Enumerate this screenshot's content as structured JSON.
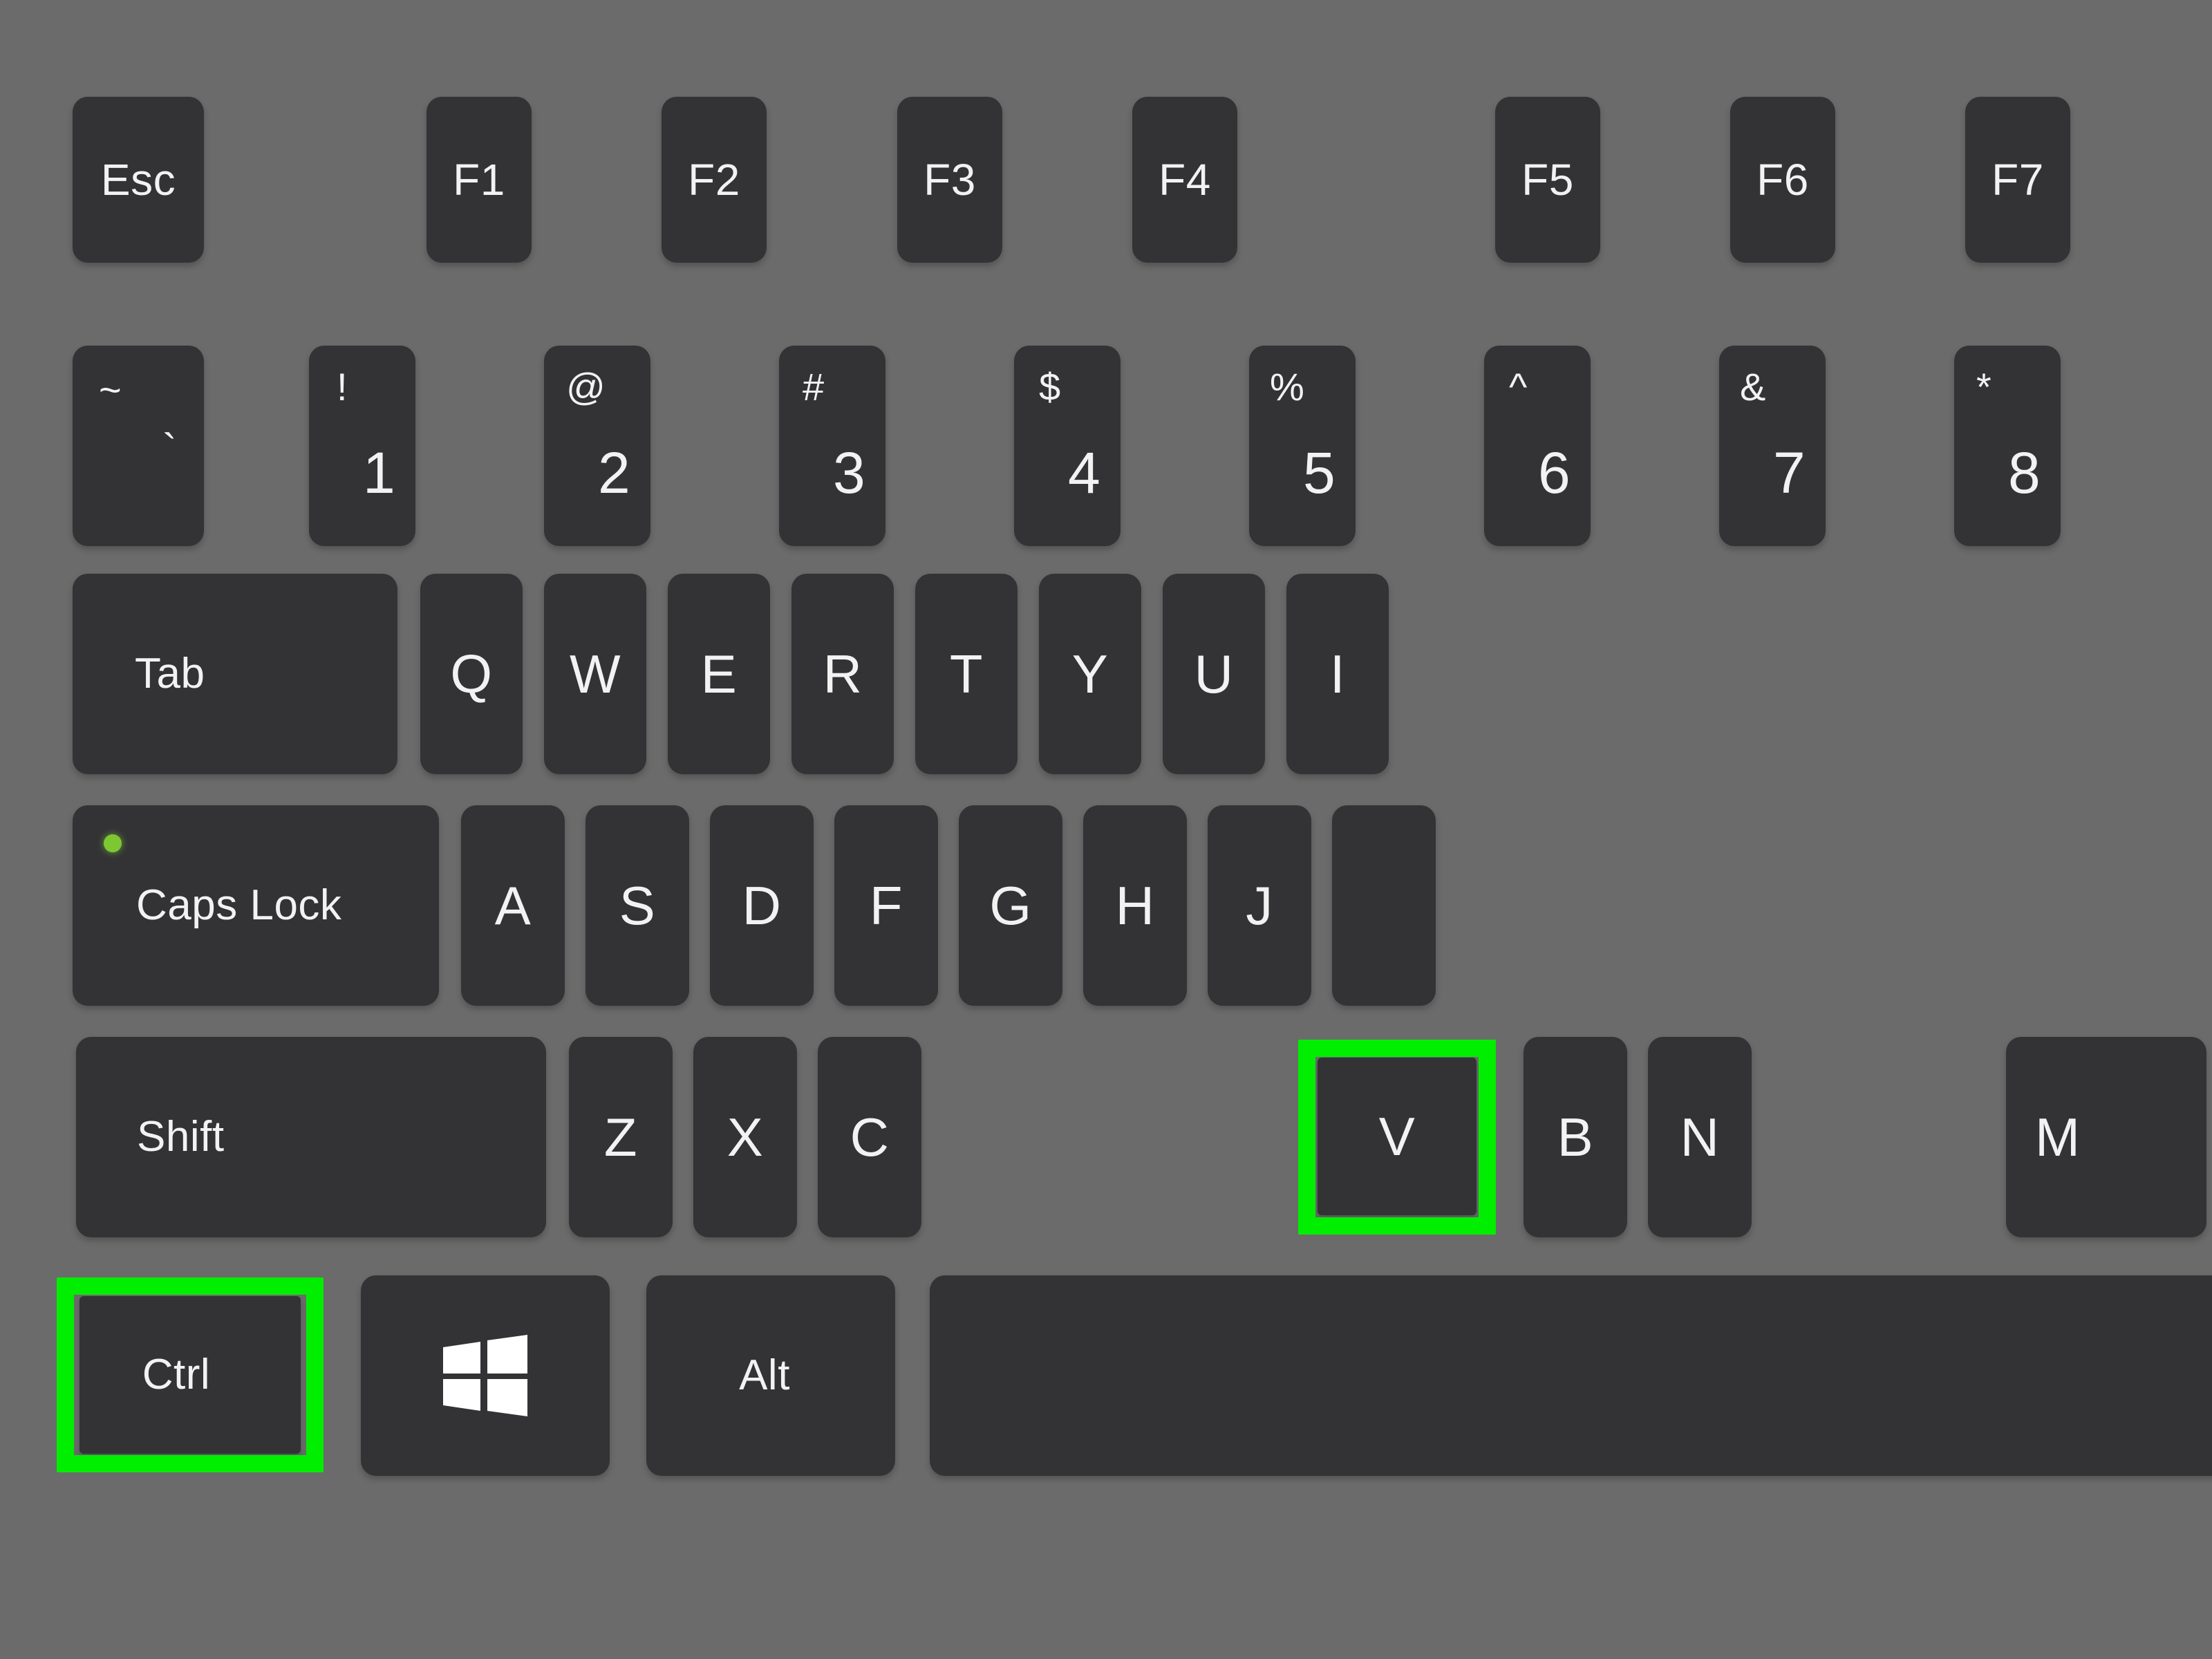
{
  "illustration": {
    "subject": "computer-keyboard",
    "layout": "ansi-qwerty-partial",
    "shortcut_shown": "Ctrl + V",
    "colors": {
      "background": "#6b6b6b",
      "keycap": "#333336",
      "legend": "#f2f2f2",
      "highlight": "#00ee00",
      "caps_lock_led": "#7dc832"
    }
  },
  "rows": {
    "function": {
      "name": "function-row",
      "keys": [
        {
          "id": "esc",
          "label": "Esc"
        },
        {
          "id": "f1",
          "label": "F1"
        },
        {
          "id": "f2",
          "label": "F2"
        },
        {
          "id": "f3",
          "label": "F3"
        },
        {
          "id": "f4",
          "label": "F4"
        },
        {
          "id": "f5",
          "label": "F5"
        },
        {
          "id": "f6",
          "label": "F6"
        },
        {
          "id": "f7",
          "label": "F7"
        }
      ]
    },
    "number": {
      "name": "number-row",
      "keys": [
        {
          "id": "backtick",
          "shifted": "~",
          "base": "`"
        },
        {
          "id": "one",
          "shifted": "!",
          "base": "1"
        },
        {
          "id": "two",
          "shifted": "@",
          "base": "2"
        },
        {
          "id": "three",
          "shifted": "#",
          "base": "3"
        },
        {
          "id": "four",
          "shifted": "$",
          "base": "4"
        },
        {
          "id": "five",
          "shifted": "%",
          "base": "5"
        },
        {
          "id": "six",
          "shifted": "^",
          "base": "6"
        },
        {
          "id": "seven",
          "shifted": "&",
          "base": "7"
        },
        {
          "id": "eight",
          "shifted": "*",
          "base": "8"
        }
      ]
    },
    "upper": {
      "name": "qwerty-row",
      "keys": [
        {
          "id": "tab",
          "label": "Tab"
        },
        {
          "id": "q",
          "label": "Q"
        },
        {
          "id": "w",
          "label": "W"
        },
        {
          "id": "e",
          "label": "E"
        },
        {
          "id": "r",
          "label": "R"
        },
        {
          "id": "t",
          "label": "T"
        },
        {
          "id": "y",
          "label": "Y"
        },
        {
          "id": "u",
          "label": "U"
        },
        {
          "id": "i",
          "label": "I"
        }
      ]
    },
    "home": {
      "name": "home-row",
      "keys": [
        {
          "id": "capslock",
          "label": "Caps Lock"
        },
        {
          "id": "a",
          "label": "A"
        },
        {
          "id": "s",
          "label": "S"
        },
        {
          "id": "d",
          "label": "D"
        },
        {
          "id": "f",
          "label": "F"
        },
        {
          "id": "g",
          "label": "G"
        },
        {
          "id": "h",
          "label": "H"
        },
        {
          "id": "j",
          "label": "J"
        },
        {
          "id": "k",
          "label": ""
        }
      ]
    },
    "lower": {
      "name": "zxcv-row",
      "keys": [
        {
          "id": "shift",
          "label": "Shift"
        },
        {
          "id": "z",
          "label": "Z"
        },
        {
          "id": "x",
          "label": "X"
        },
        {
          "id": "c",
          "label": "C"
        },
        {
          "id": "v",
          "label": "V"
        },
        {
          "id": "b",
          "label": "B"
        },
        {
          "id": "n",
          "label": "N"
        },
        {
          "id": "m",
          "label": "M"
        }
      ]
    },
    "bottom": {
      "name": "modifier-row",
      "keys": [
        {
          "id": "ctrl",
          "label": "Ctrl"
        },
        {
          "id": "win",
          "label": ""
        },
        {
          "id": "alt",
          "label": "Alt"
        },
        {
          "id": "space",
          "label": ""
        }
      ]
    }
  },
  "highlights": [
    {
      "id": "highlight-v",
      "target": "V"
    },
    {
      "id": "highlight-ctrl",
      "target": "Ctrl"
    }
  ]
}
